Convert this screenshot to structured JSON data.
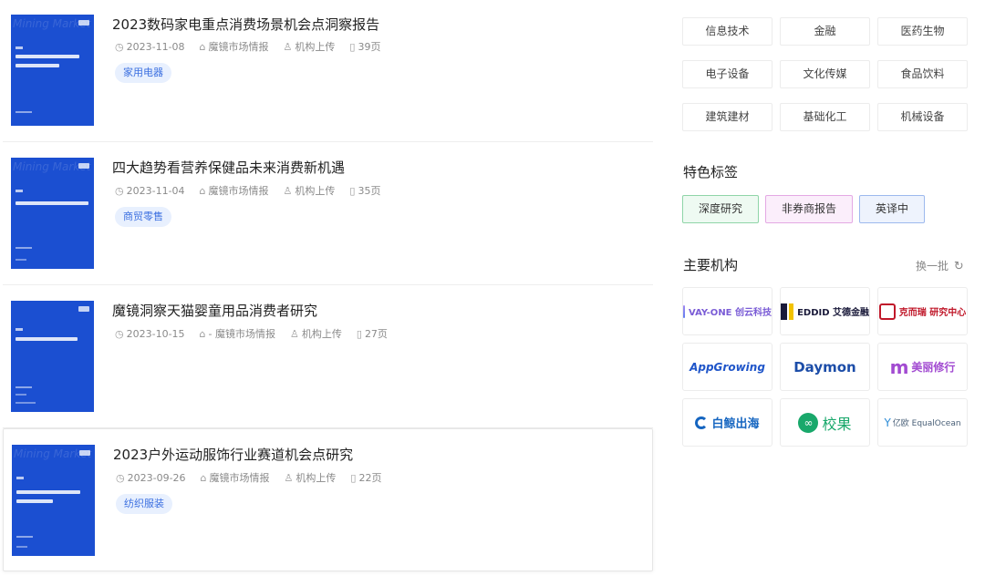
{
  "reports": [
    {
      "title": "2023数码家电重点消费场景机会点洞察报告",
      "date": "2023-11-08",
      "source": "魔镜市场情报",
      "upload": "机构上传",
      "pages": "39页",
      "tag": "家用电器",
      "cover_ghost": "Mining Market Intelligence"
    },
    {
      "title": "四大趋势看营养保健品未来消费新机遇",
      "date": "2023-11-04",
      "source": "魔镜市场情报",
      "upload": "机构上传",
      "pages": "35页",
      "tag": "商贸零售",
      "cover_ghost": "Mining Market Intelligence"
    },
    {
      "title": "魔镜洞察天猫婴童用品消费者研究",
      "date": "2023-10-15",
      "source": "- 魔镜市场情报",
      "upload": "机构上传",
      "pages": "27页",
      "tag": "",
      "cover_ghost": ""
    },
    {
      "title": "2023户外运动服饰行业赛道机会点研究",
      "date": "2023-09-26",
      "source": "魔镜市场情报",
      "upload": "机构上传",
      "pages": "22页",
      "tag": "纺织服装",
      "cover_ghost": "Mining Market Intelligence"
    }
  ],
  "industries": [
    "信息技术",
    "金融",
    "医药生物",
    "电子设备",
    "文化传媒",
    "食品饮料",
    "建筑建材",
    "基础化工",
    "机械设备"
  ],
  "featured": {
    "title": "特色标签",
    "tags": [
      {
        "label": "深度研究",
        "color": "#333333",
        "bg": "#eefaf2",
        "border": "#8fd5a8"
      },
      {
        "label": "非券商报告",
        "color": "#333333",
        "bg": "#fbeefb",
        "border": "#e4a9e4"
      },
      {
        "label": "英译中",
        "color": "#333333",
        "bg": "#eef3fd",
        "border": "#9db9ee"
      }
    ]
  },
  "institutions": {
    "title": "主要机构",
    "switch_label": "换一批",
    "logos": [
      {
        "name": "VAY-ONE 创云科技",
        "color": "#7a5cd6"
      },
      {
        "name": "EDDID 艾德金融",
        "color": "#1a1a3a"
      },
      {
        "name": "克而瑞 研究中心",
        "color": "#c0182a"
      },
      {
        "name": "AppGrowing",
        "color": "#1f55c9"
      },
      {
        "name": "Daymon",
        "color": "#1c4da8"
      },
      {
        "name": "美丽修行",
        "color": "#a24bd1"
      },
      {
        "name": "白鲸出海",
        "color": "#1565c0"
      },
      {
        "name": "校果",
        "color": "#19a86b"
      },
      {
        "name": "亿欧 EqualOcean",
        "color": "#2c8bd6"
      }
    ]
  }
}
